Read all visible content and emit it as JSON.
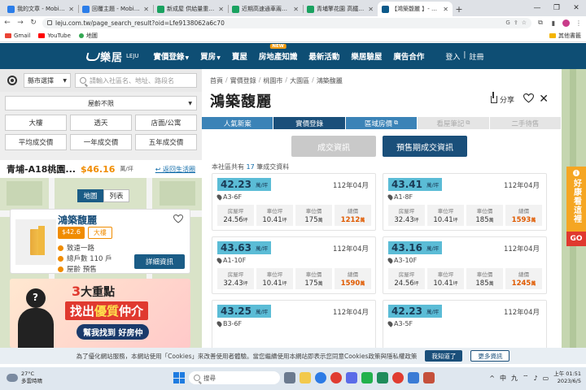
{
  "browser": {
    "tabs": [
      {
        "label": "我的文章 - Mobile01",
        "icon": "mobile01-icon"
      },
      {
        "label": "回覆主題 - Mobile01",
        "icon": "mobile01-icon"
      },
      {
        "label": "新成屋 供給量重不足",
        "icon": "sheets-icon"
      },
      {
        "label": "近期高速通車兩金走",
        "icon": "sheets-icon"
      },
      {
        "label": "青埔擎花園 高鐵電電",
        "icon": "sheets-icon"
      },
      {
        "label": "【鴻築馥麗 】- 開價&",
        "icon": "leju-icon",
        "active": true
      }
    ],
    "new_tab": "+",
    "url": "leju.com.tw/page_search_result?oid=Lfe9138062a6c70",
    "bookmarks": [
      {
        "label": "Gmail"
      },
      {
        "label": "YouTube"
      },
      {
        "label": "地圖"
      }
    ],
    "other_bookmarks": "其他書籤"
  },
  "site": {
    "logo_text": "樂居",
    "logo_sub": "LEJU",
    "nav": [
      {
        "label": "實價登錄",
        "dropdown": true
      },
      {
        "label": "買房",
        "dropdown": true
      },
      {
        "label": "賣屋",
        "dropdown": false
      },
      {
        "label": "房地產知識",
        "dropdown": false,
        "badge": "NEW"
      },
      {
        "label": "最新活動",
        "dropdown": false
      },
      {
        "label": "樂居驗屋",
        "dropdown": false
      },
      {
        "label": "廣告合作",
        "dropdown": false
      }
    ],
    "login": "登入",
    "auth_sep": "|",
    "register": "註冊"
  },
  "left": {
    "city_select": "縣市選擇",
    "search_placeholder": "請輸入社區名、地址、路段名",
    "age_select": "屋齡不限",
    "filters": [
      "大樓",
      "透天",
      "店面/公寓",
      "平均成交價",
      "一年成交價",
      "五年成交價"
    ],
    "project_name": "青埔-A18桃園...",
    "project_price": "$46.16",
    "project_unit": "萬/坪",
    "back_link": "返回生活圈",
    "view_map": "地圖",
    "view_list": "列表",
    "card": {
      "title": "鴻築馥麗",
      "price_tag": "$42.6",
      "type_tag": "大樓",
      "address": "致遠一路",
      "households": "總戶數 110 戶",
      "age": "屋齡 預售",
      "detail_button": "詳細資訊"
    },
    "ad": {
      "line1_num": "3",
      "line1_rest": "大重點",
      "line2_a": "找出",
      "line2_hi": "優質",
      "line2_b": "仲介",
      "line3": "幫我找到 好房仲",
      "question_mark": "?"
    }
  },
  "main": {
    "breadcrumbs": [
      "首頁",
      "實價登錄",
      "桃園市",
      "大園區",
      "鴻築馥麗"
    ],
    "crumb_sep": "/",
    "title": "鴻築馥麗",
    "share": "分享",
    "subtabs": [
      {
        "label": "人氣新案",
        "state": "normal"
      },
      {
        "label": "實價登錄",
        "state": "active"
      },
      {
        "label": "區域房價",
        "state": "normal",
        "ext": true
      },
      {
        "label": "看屋筆記",
        "state": "disabled",
        "ext": true
      },
      {
        "label": "二手待售",
        "state": "disabled"
      }
    ],
    "mode_deal": "成交資訊",
    "mode_presale": "預售期成交資訊",
    "count_prefix": "本社區共有",
    "count_value": "17",
    "count_suffix": "筆成交資料",
    "labels": {
      "unit_price": "萬/坪",
      "area": "房屋坪",
      "parking_area": "車位坪",
      "parking_price": "車位價",
      "total": "總價"
    },
    "records": [
      {
        "price": "42.23",
        "date": "112年04月",
        "unit": "A3-6F",
        "area": "24.56",
        "parking_area": "10.41",
        "parking_price": "175",
        "total": "1212"
      },
      {
        "price": "43.41",
        "date": "112年04月",
        "unit": "A1-8F",
        "area": "32.43",
        "parking_area": "10.41",
        "parking_price": "185",
        "total": "1593"
      },
      {
        "price": "43.63",
        "date": "112年04月",
        "unit": "A1-10F",
        "area": "32.43",
        "parking_area": "10.41",
        "parking_price": "175",
        "total": "1590"
      },
      {
        "price": "43.16",
        "date": "112年04月",
        "unit": "A3-10F",
        "area": "24.56",
        "parking_area": "10.41",
        "parking_price": "185",
        "total": "1245"
      },
      {
        "price": "43.25",
        "date": "112年04月",
        "unit": "B3-6F",
        "area": "",
        "parking_area": "",
        "parking_price": "",
        "total": ""
      },
      {
        "price": "42.23",
        "date": "112年04月",
        "unit": "A3-5F",
        "area": "",
        "parking_area": "",
        "parking_price": "",
        "total": ""
      }
    ],
    "unit_ping": "坪",
    "unit_wan": "萬"
  },
  "promo": {
    "info": "i",
    "text": "好康看這裡",
    "go": "GO"
  },
  "cookie": {
    "message": "為了優化網站服務，本網站使用「Cookies」來改善使用者體驗。當您繼續使用本網站即表示您同意Cookies政策與隱私權政策",
    "agree": "我知道了",
    "more": "更多資訊"
  },
  "taskbar": {
    "temp": "27°C",
    "weather": "多雲時晴",
    "search": "搜尋",
    "tray_up": "^",
    "ime": "中",
    "lang": "九",
    "time": "上午 01:51",
    "date": "2023/6/5"
  }
}
